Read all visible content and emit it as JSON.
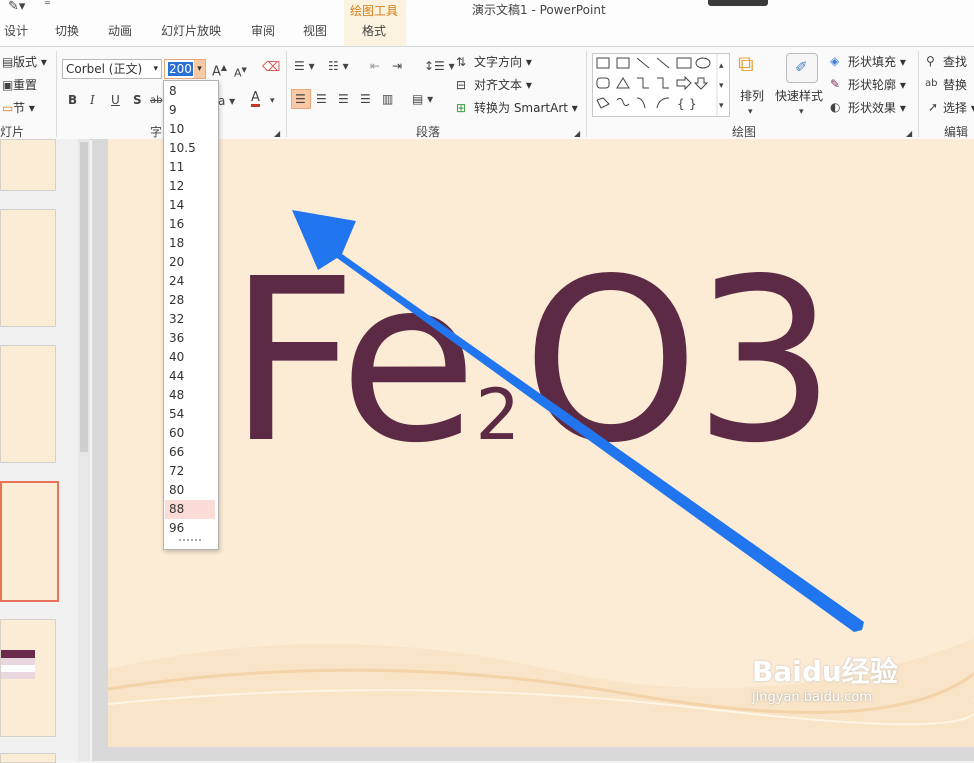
{
  "window": {
    "title": "演示文稿1 - PowerPoint",
    "contextual_tab_header": "绘图工具"
  },
  "tabs": [
    "设计",
    "切换",
    "动画",
    "幻灯片放映",
    "审阅",
    "视图",
    "格式"
  ],
  "ribbon": {
    "slides_group": {
      "layout_label": "版式",
      "reset_label": "重置",
      "section_label": "节",
      "group_label_partial": "灯片"
    },
    "font_group": {
      "font_name": "Corbel (正文)",
      "font_size_value": "200",
      "group_label_partial": "字"
    },
    "paragraph_group": {
      "text_direction_label": "文字方向",
      "align_text_label": "对齐文本",
      "convert_smartart_label": "转换为 SmartArt",
      "group_label": "段落"
    },
    "drawing_group": {
      "arrange_label": "排列",
      "quick_styles_label": "快速样式",
      "shape_fill_label": "形状填充",
      "shape_outline_label": "形状轮廓",
      "shape_effects_label": "形状效果",
      "group_label": "绘图"
    },
    "editing_group": {
      "find_label": "查找",
      "replace_label": "替换",
      "select_label": "选择",
      "group_label": "编辑"
    }
  },
  "font_size_dropdown": {
    "options": [
      "8",
      "9",
      "10",
      "10.5",
      "11",
      "12",
      "14",
      "16",
      "18",
      "20",
      "24",
      "28",
      "32",
      "36",
      "40",
      "44",
      "48",
      "54",
      "60",
      "66",
      "72",
      "80",
      "88",
      "96"
    ],
    "highlighted": "88"
  },
  "slide": {
    "formula_base": "Fe",
    "formula_subscript": "2",
    "formula_rest": "O3",
    "text_color": "#5c2a44",
    "background": "#fcebd5"
  },
  "annotation_arrow": {
    "color": "#2176f0"
  },
  "watermark": {
    "brand": "Baidu经验",
    "url": "jingyan.baidu.com"
  },
  "colors": {
    "accent_orange": "#d47d10",
    "selection": "#f9c9a6"
  }
}
